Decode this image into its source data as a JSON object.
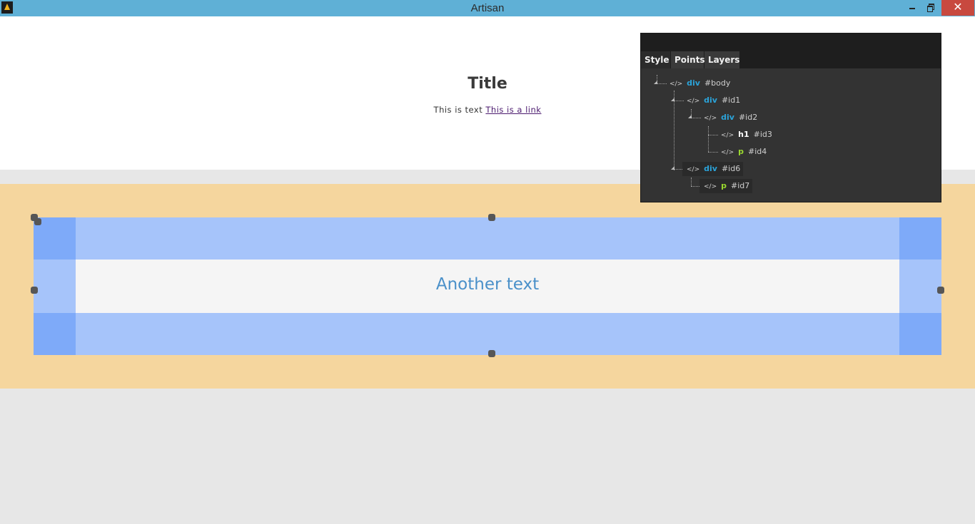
{
  "window": {
    "title": "Artisan",
    "close_glyph": "✕"
  },
  "canvas": {
    "title": "Title",
    "text": "This is text",
    "link": "This is a link",
    "selected_text": "Another text"
  },
  "panel": {
    "tabs": [
      "Style",
      "Points",
      "Layers"
    ],
    "tree": [
      {
        "tag": "div",
        "id": "#body"
      },
      {
        "tag": "div",
        "id": "#id1"
      },
      {
        "tag": "div",
        "id": "#id2"
      },
      {
        "tag": "h1",
        "id": "#id3"
      },
      {
        "tag": "p",
        "id": "#id4"
      },
      {
        "tag": "div",
        "id": "#id6"
      },
      {
        "tag": "p",
        "id": "#id7"
      }
    ],
    "code_icon": "</>"
  },
  "colors": {
    "titlebar": "#5fb0d6",
    "margin": "#f5d69e",
    "padding": "#a6c4fa",
    "content": "#f5f5f5",
    "accent_text": "#4a90c9",
    "panel_bg": "#333333"
  }
}
